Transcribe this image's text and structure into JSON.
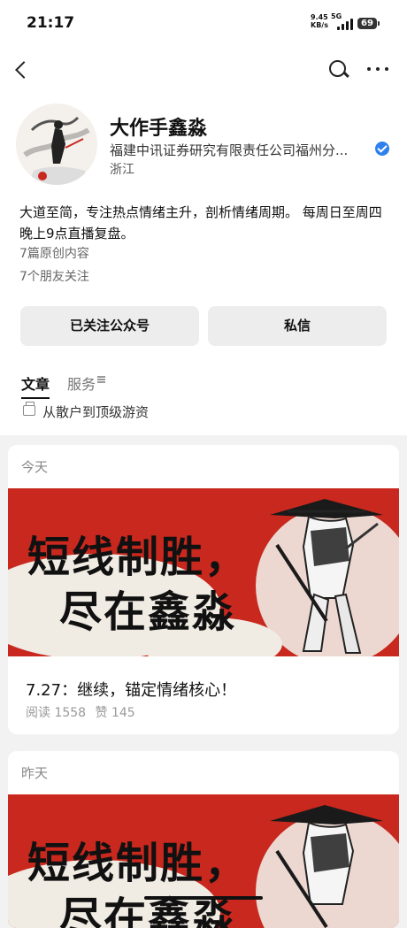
{
  "status": {
    "time": "21:17",
    "network_speed_value": "9.45",
    "network_speed_unit": "KB/s",
    "network_type": "5G",
    "battery": "69"
  },
  "nav": {
    "back_icon": "back-arrow-icon",
    "search_icon": "search-icon",
    "more_icon": "more-icon"
  },
  "profile": {
    "name": "大作手鑫淼",
    "company": "福建中讯证券研究有限责任公司福州分...",
    "location": "浙江",
    "description": "大道至简，专注热点情绪主升，剖析情绪周期。 每周日至周四晚上9点直播复盘。",
    "original_count": "7篇原创内容",
    "friends_following": "7个朋友关注"
  },
  "actions": {
    "follow": "已关注公众号",
    "message": "私信"
  },
  "tabs": {
    "articles": "文章",
    "services": "服务"
  },
  "collection": {
    "label": "从散户到顶级游资"
  },
  "articles": [
    {
      "day": "今天",
      "cover_line1": "短线制胜，",
      "cover_line2": "尽在鑫淼",
      "title": "7.27：继续，锚定情绪核心！",
      "reads": "阅读 1558",
      "likes": "赞 145"
    },
    {
      "day": "昨天",
      "cover_line1": "短线制胜，",
      "cover_line2": "尽在鑫淼"
    }
  ],
  "colors": {
    "accent_red": "#c8281e",
    "verified_blue": "#2f80ed"
  }
}
